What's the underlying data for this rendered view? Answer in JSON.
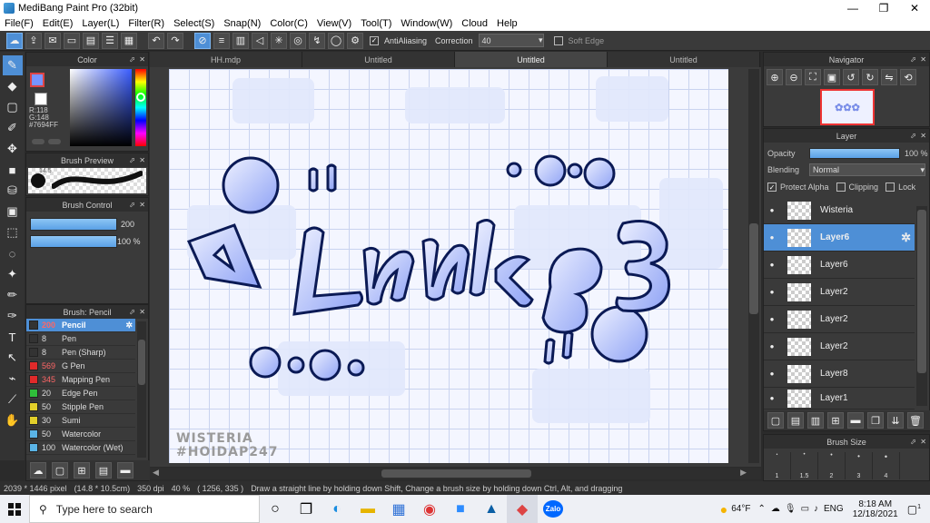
{
  "window": {
    "title": "MediBang Paint Pro (32bit)",
    "minimize": "—",
    "restore": "❐",
    "close": "✕"
  },
  "menu": [
    "File(F)",
    "Edit(E)",
    "Layer(L)",
    "Filter(R)",
    "Select(S)",
    "Snap(N)",
    "Color(C)",
    "View(V)",
    "Tool(T)",
    "Window(W)",
    "Cloud",
    "Help"
  ],
  "toolbar": {
    "antialiasing_label": "AntiAliasing",
    "correction_label": "Correction",
    "correction_value": "40",
    "soft_edge_label": "Soft Edge"
  },
  "tabs": [
    "HH.mdp",
    "Untitled",
    "Untitled",
    "Untitled"
  ],
  "color_panel": {
    "title": "Color",
    "r": "R:118",
    "g": "G:148",
    "hex": "#7694FF",
    "fg_color": "#7694ff",
    "bg_color": "#ffffff"
  },
  "brush_preview": {
    "title": "Brush Preview",
    "size": "14.5"
  },
  "brush_control": {
    "title": "Brush Control",
    "size_value": "200",
    "opacity_value": "100 %"
  },
  "brush_list": {
    "title": "Brush: Pencil",
    "items": [
      {
        "size": "200",
        "name": "Pencil",
        "color": "#333333"
      },
      {
        "size": "8",
        "name": "Pen",
        "color": "#333333"
      },
      {
        "size": "8",
        "name": "Pen (Sharp)",
        "color": "#333333"
      },
      {
        "size": "569",
        "name": "G Pen",
        "color": "#e02a2a"
      },
      {
        "size": "345",
        "name": "Mapping Pen",
        "color": "#e02a2a"
      },
      {
        "size": "20",
        "name": "Edge Pen",
        "color": "#2fbf3a"
      },
      {
        "size": "50",
        "name": "Stipple Pen",
        "color": "#e2cf2a"
      },
      {
        "size": "30",
        "name": "Sumi",
        "color": "#e2cf2a"
      },
      {
        "size": "50",
        "name": "Watercolor",
        "color": "#5ab4e6"
      },
      {
        "size": "100",
        "name": "Watercolor (Wet)",
        "color": "#5ab4e6"
      }
    ]
  },
  "navigator": {
    "title": "Navigator"
  },
  "layer_panel": {
    "title": "Layer",
    "opacity_label": "Opacity",
    "opacity_value": "100 %",
    "blending_label": "Blending",
    "blending_value": "Normal",
    "protect_alpha": "Protect Alpha",
    "clipping": "Clipping",
    "lock": "Lock",
    "layers": [
      "Wisteria",
      "Layer6",
      "Layer6",
      "Layer2",
      "Layer2",
      "Layer2",
      "Layer8",
      "Layer1"
    ]
  },
  "brush_size": {
    "title": "Brush Size",
    "sizes": [
      "1",
      "1.5",
      "2",
      "3",
      "4"
    ]
  },
  "canvas": {
    "watermark_line1": "WISTERIA",
    "watermark_line2": "#HOIDAP247"
  },
  "status": {
    "dimensions": "2039 * 1446 pixel",
    "physical": "(14.8 * 10.5cm)",
    "dpi": "350 dpi",
    "zoom": "40 %",
    "coords": "( 1256, 335 )",
    "hint": "Draw a straight line by holding down Shift, Change a brush size by holding down Ctrl, Alt, and dragging"
  },
  "taskbar": {
    "search_placeholder": "Type here to search",
    "weather": "64°F",
    "lang": "ENG",
    "time": "8:18 AM",
    "date": "12/18/2021",
    "notifications": "1",
    "zalo": "Zalo"
  }
}
